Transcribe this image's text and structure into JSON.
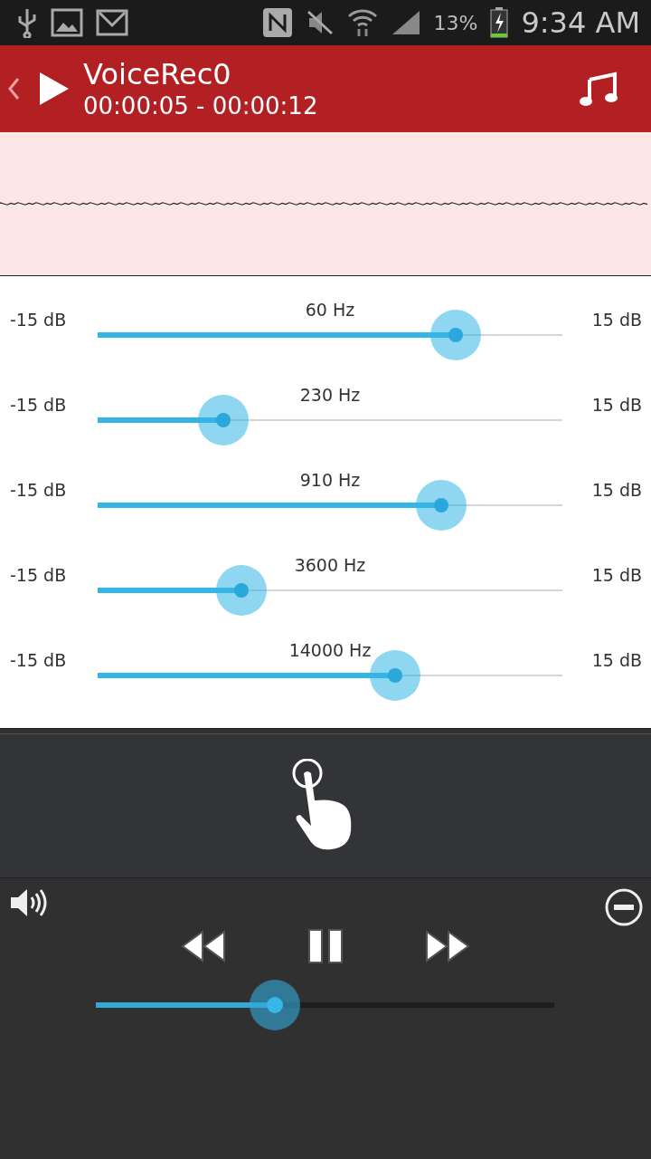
{
  "status_bar": {
    "battery_percent": "13%",
    "time": "9:34 AM"
  },
  "header": {
    "title": "VoiceRec0",
    "time_range": "00:00:05 - 00:00:12"
  },
  "equalizer": {
    "bands": [
      {
        "label": "60 Hz",
        "min": "-15 dB",
        "max": "15 dB",
        "level": 0.77
      },
      {
        "label": "230 Hz",
        "min": "-15 dB",
        "max": "15 dB",
        "level": 0.27
      },
      {
        "label": "910 Hz",
        "min": "-15 dB",
        "max": "15 dB",
        "level": 0.74
      },
      {
        "label": "3600 Hz",
        "min": "-15 dB",
        "max": "15 dB",
        "level": 0.31
      },
      {
        "label": "14000 Hz",
        "min": "-15 dB",
        "max": "15 dB",
        "level": 0.64
      }
    ]
  },
  "player": {
    "level": 0.39
  }
}
